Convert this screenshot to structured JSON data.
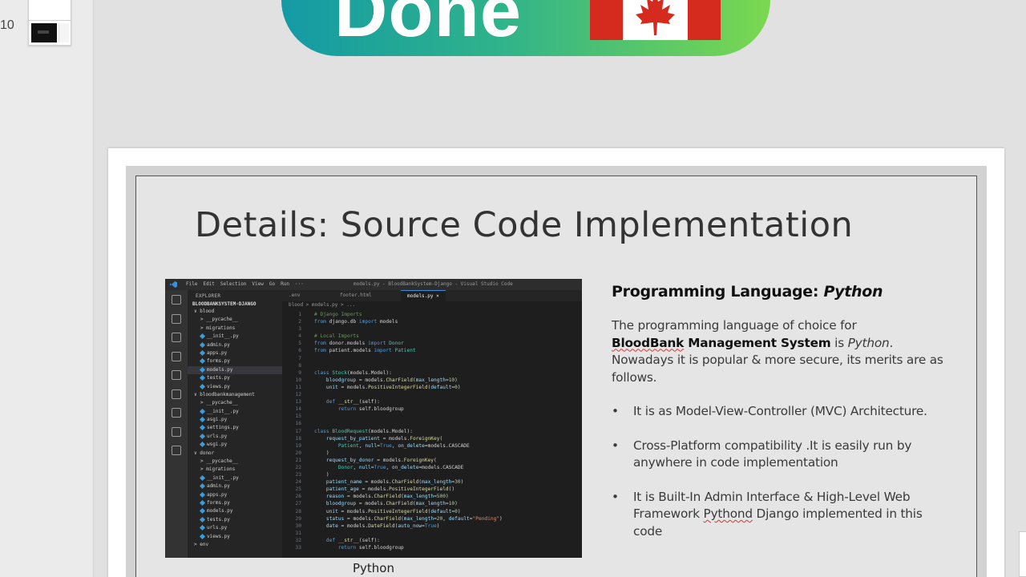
{
  "thumbnails": {
    "slide_number": "10"
  },
  "prev_slide": {
    "banner_text": "Done",
    "flag_colors": [
      "#d52b1e",
      "#ffffff"
    ]
  },
  "slide": {
    "title": "Details: Source Code Implementation",
    "image_caption": "Python",
    "heading_prefix": "Programming Language: ",
    "heading_lang": "Python",
    "intro": {
      "p1": "The programming language of choice for",
      "p2_bold_a": "BloodBank",
      "p2_bold_b": " Management System",
      "p2_rest_a": " is ",
      "p2_rest_italic": "Python",
      "p2_rest_b": ".",
      "p3": "Nowadays it is popular & more secure, its merits are as follows."
    },
    "bullets": [
      {
        "text": "It is as Model-View-Controller (MVC) Architecture."
      },
      {
        "text": "Cross-Platform compatibility .It is easily run by anywhere in code implementation"
      },
      {
        "pre": "It is Built-In Admin Interface & High-Level Web Framework ",
        "squig": "Pythond",
        "post": " Django implemented in this code"
      }
    ]
  },
  "vscode": {
    "menu": [
      "File",
      "Edit",
      "Selection",
      "View",
      "Go",
      "Run",
      "···"
    ],
    "window_title": "models.py - BloodBankSystem-Django - Visual Studio Code",
    "explorer_header": "EXPLORER",
    "project": "BLOODBANKSYSTEM-DJANGO",
    "tree": [
      {
        "label": "∨ blood",
        "indent": 1,
        "file": false
      },
      {
        "label": "> __pycache__",
        "indent": 2,
        "file": false
      },
      {
        "label": "> migrations",
        "indent": 2,
        "file": false
      },
      {
        "label": "__init__.py",
        "indent": 2,
        "file": true
      },
      {
        "label": "admin.py",
        "indent": 2,
        "file": true
      },
      {
        "label": "apps.py",
        "indent": 2,
        "file": true
      },
      {
        "label": "forms.py",
        "indent": 2,
        "file": true
      },
      {
        "label": "models.py",
        "indent": 2,
        "file": true,
        "selected": true
      },
      {
        "label": "tests.py",
        "indent": 2,
        "file": true
      },
      {
        "label": "views.py",
        "indent": 2,
        "file": true
      },
      {
        "label": "∨ bloodbankmanagement",
        "indent": 1,
        "file": false
      },
      {
        "label": "> __pycache__",
        "indent": 2,
        "file": false
      },
      {
        "label": "__init__.py",
        "indent": 2,
        "file": true
      },
      {
        "label": "asgi.py",
        "indent": 2,
        "file": true
      },
      {
        "label": "settings.py",
        "indent": 2,
        "file": true
      },
      {
        "label": "urls.py",
        "indent": 2,
        "file": true
      },
      {
        "label": "wsgi.py",
        "indent": 2,
        "file": true
      },
      {
        "label": "∨ donor",
        "indent": 1,
        "file": false
      },
      {
        "label": "> __pycache__",
        "indent": 2,
        "file": false
      },
      {
        "label": "> migrations",
        "indent": 2,
        "file": false
      },
      {
        "label": "__init__.py",
        "indent": 2,
        "file": true
      },
      {
        "label": "admin.py",
        "indent": 2,
        "file": true
      },
      {
        "label": "apps.py",
        "indent": 2,
        "file": true
      },
      {
        "label": "forms.py",
        "indent": 2,
        "file": true
      },
      {
        "label": "models.py",
        "indent": 2,
        "file": true
      },
      {
        "label": "tests.py",
        "indent": 2,
        "file": true
      },
      {
        "label": "urls.py",
        "indent": 2,
        "file": true
      },
      {
        "label": "views.py",
        "indent": 2,
        "file": true
      },
      {
        "label": "> env",
        "indent": 1,
        "file": false
      }
    ],
    "tabs": [
      {
        "label": ".env"
      },
      {
        "label": "footer.html"
      },
      {
        "label": "models.py  ×",
        "active": true
      }
    ],
    "breadcrumb": "blood > models.py > ...",
    "code": [
      {
        "n": "1",
        "t": [
          [
            "cm",
            "# Django Imports"
          ]
        ]
      },
      {
        "n": "2",
        "t": [
          [
            "kw",
            "from "
          ],
          [
            "tx",
            "django.db "
          ],
          [
            "kw",
            "import "
          ],
          [
            "tx",
            "models"
          ]
        ]
      },
      {
        "n": "3",
        "t": []
      },
      {
        "n": "4",
        "t": [
          [
            "cm",
            "# Local Imports"
          ]
        ]
      },
      {
        "n": "5",
        "t": [
          [
            "kw",
            "from "
          ],
          [
            "tx",
            "donor.models "
          ],
          [
            "kw",
            "import "
          ],
          [
            "cls",
            "Donor"
          ]
        ]
      },
      {
        "n": "6",
        "t": [
          [
            "kw",
            "from "
          ],
          [
            "tx",
            "patient.models "
          ],
          [
            "kw",
            "import "
          ],
          [
            "cls",
            "Patient"
          ]
        ]
      },
      {
        "n": "7",
        "t": []
      },
      {
        "n": "8",
        "t": []
      },
      {
        "n": "9",
        "t": [
          [
            "kw",
            "class "
          ],
          [
            "cls",
            "Stock"
          ],
          [
            "tx",
            "(models.Model):"
          ]
        ]
      },
      {
        "n": "10",
        "t": [
          [
            "tx",
            "    "
          ],
          [
            "pa",
            "bloodgroup"
          ],
          [
            "tx",
            " = models."
          ],
          [
            "fn",
            "CharField"
          ],
          [
            "tx",
            "("
          ],
          [
            "pa",
            "max_length"
          ],
          [
            "tx",
            "="
          ],
          [
            "nm",
            "10"
          ],
          [
            "tx",
            ")"
          ]
        ]
      },
      {
        "n": "11",
        "t": [
          [
            "tx",
            "    "
          ],
          [
            "pa",
            "unit"
          ],
          [
            "tx",
            " = models."
          ],
          [
            "fn",
            "PositiveIntegerField"
          ],
          [
            "tx",
            "("
          ],
          [
            "pa",
            "default"
          ],
          [
            "tx",
            "="
          ],
          [
            "nm",
            "0"
          ],
          [
            "tx",
            ")"
          ]
        ]
      },
      {
        "n": "12",
        "t": []
      },
      {
        "n": "13",
        "t": [
          [
            "tx",
            "    "
          ],
          [
            "kw",
            "def "
          ],
          [
            "fn",
            "__str__"
          ],
          [
            "tx",
            "(self):"
          ]
        ]
      },
      {
        "n": "14",
        "t": [
          [
            "tx",
            "        "
          ],
          [
            "kw",
            "return "
          ],
          [
            "tx",
            "self.bloodgroup"
          ]
        ]
      },
      {
        "n": "15",
        "t": []
      },
      {
        "n": "16",
        "t": []
      },
      {
        "n": "17",
        "t": [
          [
            "kw",
            "class "
          ],
          [
            "cls",
            "BloodRequest"
          ],
          [
            "tx",
            "(models.Model):"
          ]
        ]
      },
      {
        "n": "18",
        "t": [
          [
            "tx",
            "    "
          ],
          [
            "pa",
            "request_by_patient"
          ],
          [
            "tx",
            " = models."
          ],
          [
            "fn",
            "ForeignKey"
          ],
          [
            "tx",
            "("
          ]
        ]
      },
      {
        "n": "19",
        "t": [
          [
            "tx",
            "        "
          ],
          [
            "cls",
            "Patient"
          ],
          [
            "tx",
            ", "
          ],
          [
            "pa",
            "null"
          ],
          [
            "tx",
            "="
          ],
          [
            "kw",
            "True"
          ],
          [
            "tx",
            ", "
          ],
          [
            "pa",
            "on_delete"
          ],
          [
            "tx",
            "=models.CASCADE"
          ]
        ]
      },
      {
        "n": "20",
        "t": [
          [
            "tx",
            "    )"
          ]
        ]
      },
      {
        "n": "21",
        "t": [
          [
            "tx",
            "    "
          ],
          [
            "pa",
            "request_by_donor"
          ],
          [
            "tx",
            " = models."
          ],
          [
            "fn",
            "ForeignKey"
          ],
          [
            "tx",
            "("
          ]
        ]
      },
      {
        "n": "22",
        "t": [
          [
            "tx",
            "        "
          ],
          [
            "cls",
            "Donor"
          ],
          [
            "tx",
            ", "
          ],
          [
            "pa",
            "null"
          ],
          [
            "tx",
            "="
          ],
          [
            "kw",
            "True"
          ],
          [
            "tx",
            ", "
          ],
          [
            "pa",
            "on_delete"
          ],
          [
            "tx",
            "=models.CASCADE"
          ]
        ]
      },
      {
        "n": "23",
        "t": [
          [
            "tx",
            "    )"
          ]
        ]
      },
      {
        "n": "24",
        "t": [
          [
            "tx",
            "    "
          ],
          [
            "pa",
            "patient_name"
          ],
          [
            "tx",
            " = models."
          ],
          [
            "fn",
            "CharField"
          ],
          [
            "tx",
            "("
          ],
          [
            "pa",
            "max_length"
          ],
          [
            "tx",
            "="
          ],
          [
            "nm",
            "30"
          ],
          [
            "tx",
            ")"
          ]
        ]
      },
      {
        "n": "25",
        "t": [
          [
            "tx",
            "    "
          ],
          [
            "pa",
            "patient_age"
          ],
          [
            "tx",
            " = models."
          ],
          [
            "fn",
            "PositiveIntegerField"
          ],
          [
            "tx",
            "()"
          ]
        ]
      },
      {
        "n": "26",
        "t": [
          [
            "tx",
            "    "
          ],
          [
            "pa",
            "reason"
          ],
          [
            "tx",
            " = models."
          ],
          [
            "fn",
            "CharField"
          ],
          [
            "tx",
            "("
          ],
          [
            "pa",
            "max_length"
          ],
          [
            "tx",
            "="
          ],
          [
            "nm",
            "500"
          ],
          [
            "tx",
            ")"
          ]
        ]
      },
      {
        "n": "27",
        "t": [
          [
            "tx",
            "    "
          ],
          [
            "pa",
            "bloodgroup"
          ],
          [
            "tx",
            " = models."
          ],
          [
            "fn",
            "CharField"
          ],
          [
            "tx",
            "("
          ],
          [
            "pa",
            "max_length"
          ],
          [
            "tx",
            "="
          ],
          [
            "nm",
            "10"
          ],
          [
            "tx",
            ")"
          ]
        ]
      },
      {
        "n": "28",
        "t": [
          [
            "tx",
            "    "
          ],
          [
            "pa",
            "unit"
          ],
          [
            "tx",
            " = models."
          ],
          [
            "fn",
            "PositiveIntegerField"
          ],
          [
            "tx",
            "("
          ],
          [
            "pa",
            "default"
          ],
          [
            "tx",
            "="
          ],
          [
            "nm",
            "0"
          ],
          [
            "tx",
            ")"
          ]
        ]
      },
      {
        "n": "29",
        "t": [
          [
            "tx",
            "    "
          ],
          [
            "pa",
            "status"
          ],
          [
            "tx",
            " = models."
          ],
          [
            "fn",
            "CharField"
          ],
          [
            "tx",
            "("
          ],
          [
            "pa",
            "max_length"
          ],
          [
            "tx",
            "="
          ],
          [
            "nm",
            "20"
          ],
          [
            "tx",
            ", "
          ],
          [
            "pa",
            "default"
          ],
          [
            "tx",
            "="
          ],
          [
            "st",
            "\"Pending\""
          ],
          [
            "tx",
            ")"
          ]
        ]
      },
      {
        "n": "30",
        "t": [
          [
            "tx",
            "    "
          ],
          [
            "pa",
            "date"
          ],
          [
            "tx",
            " = models."
          ],
          [
            "fn",
            "DateField"
          ],
          [
            "tx",
            "("
          ],
          [
            "pa",
            "auto_now"
          ],
          [
            "tx",
            "="
          ],
          [
            "kw",
            "True"
          ],
          [
            "tx",
            ")"
          ]
        ]
      },
      {
        "n": "31",
        "t": []
      },
      {
        "n": "32",
        "t": [
          [
            "tx",
            "    "
          ],
          [
            "kw",
            "def "
          ],
          [
            "fn",
            "__str__"
          ],
          [
            "tx",
            "(self):"
          ]
        ]
      },
      {
        "n": "33",
        "t": [
          [
            "tx",
            "        "
          ],
          [
            "kw",
            "return "
          ],
          [
            "tx",
            "self.bloodgroup"
          ]
        ]
      }
    ]
  },
  "icons": {
    "bullet": "•",
    "activity_bar": [
      "files-icon",
      "search-icon",
      "source-control-icon",
      "run-debug-icon",
      "extensions-icon",
      "remote-icon",
      "testing-icon",
      "charts-icon",
      "docker-icon"
    ]
  }
}
